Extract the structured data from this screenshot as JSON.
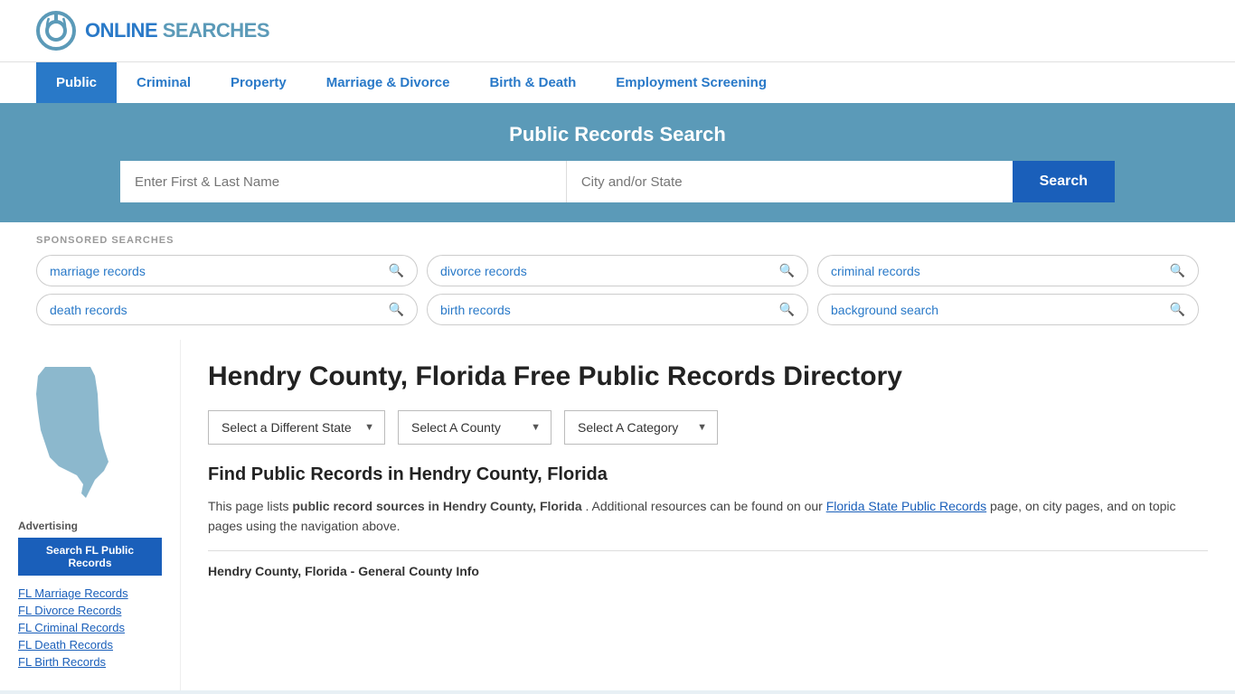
{
  "header": {
    "logo_text_plain": "ONLINE",
    "logo_text_brand": "SEARCHES",
    "logo_alt": "OnlineSearches logo"
  },
  "nav": {
    "items": [
      {
        "label": "Public",
        "active": true
      },
      {
        "label": "Criminal",
        "active": false
      },
      {
        "label": "Property",
        "active": false
      },
      {
        "label": "Marriage & Divorce",
        "active": false
      },
      {
        "label": "Birth & Death",
        "active": false
      },
      {
        "label": "Employment Screening",
        "active": false
      }
    ]
  },
  "search_banner": {
    "title": "Public Records Search",
    "name_placeholder": "Enter First & Last Name",
    "location_placeholder": "City and/or State",
    "button_label": "Search"
  },
  "sponsored": {
    "label": "SPONSORED SEARCHES",
    "tags": [
      [
        "marriage records",
        "divorce records",
        "criminal records"
      ],
      [
        "death records",
        "birth records",
        "background search"
      ]
    ]
  },
  "sidebar": {
    "map_alt": "Florida map",
    "ad_label": "Advertising",
    "ad_button": "Search FL Public Records",
    "links": [
      "FL Marriage Records",
      "FL Divorce Records",
      "FL Criminal Records",
      "FL Death Records",
      "FL Birth Records"
    ]
  },
  "content": {
    "title": "Hendry County, Florida Free Public Records Directory",
    "dropdown_state": "Select a Different State",
    "dropdown_county": "Select A County",
    "dropdown_category": "Select A Category",
    "find_title": "Find Public Records in Hendry County, Florida",
    "find_desc_prefix": "This page lists ",
    "find_desc_bold": "public record sources in Hendry County, Florida",
    "find_desc_mid": ". Additional resources can be found on our ",
    "find_desc_link": "Florida State Public Records",
    "find_desc_suffix": " page, on city pages, and on topic pages using the navigation above.",
    "section_subhead": "Hendry County, Florida - General County Info"
  }
}
